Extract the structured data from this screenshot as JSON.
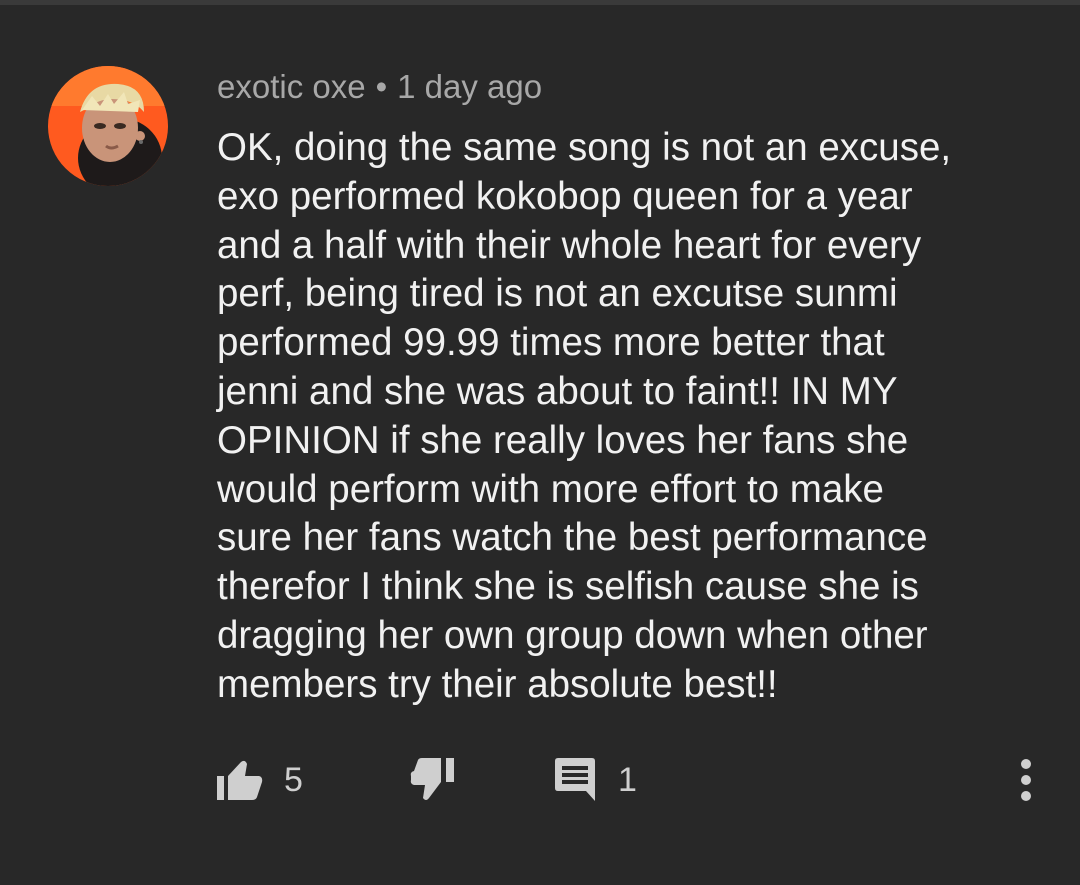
{
  "comment": {
    "author": "exotic oxe",
    "separator": "•",
    "timestamp": "1 day ago",
    "text_lines": [
      "OK, doing the same song is not an excuse,",
      "exo performed kokobop queen for a year",
      "and a half with their whole heart for every",
      "perf, being tired is not an excutse sunmi",
      "performed 99.99 times more better that",
      "jenni and she was about to faint!! IN MY",
      "OPINION if she really loves her fans she",
      "would perform with more effort to make",
      "sure her fans watch the best performance",
      "therefor I think she is selfish cause she is",
      "dragging her own group down when other",
      "members try their absolute best!!"
    ],
    "likes": "5",
    "replies": "1",
    "avatar_icon": "user-avatar",
    "like_icon": "thumbs-up-icon",
    "dislike_icon": "thumbs-down-icon",
    "reply_icon": "reply-icon",
    "more_icon": "more-vertical-icon"
  },
  "colors": {
    "background": "#282828",
    "text_primary": "#f1f1f1",
    "text_secondary": "#a8a8a8",
    "icon": "#cfcfcf"
  }
}
